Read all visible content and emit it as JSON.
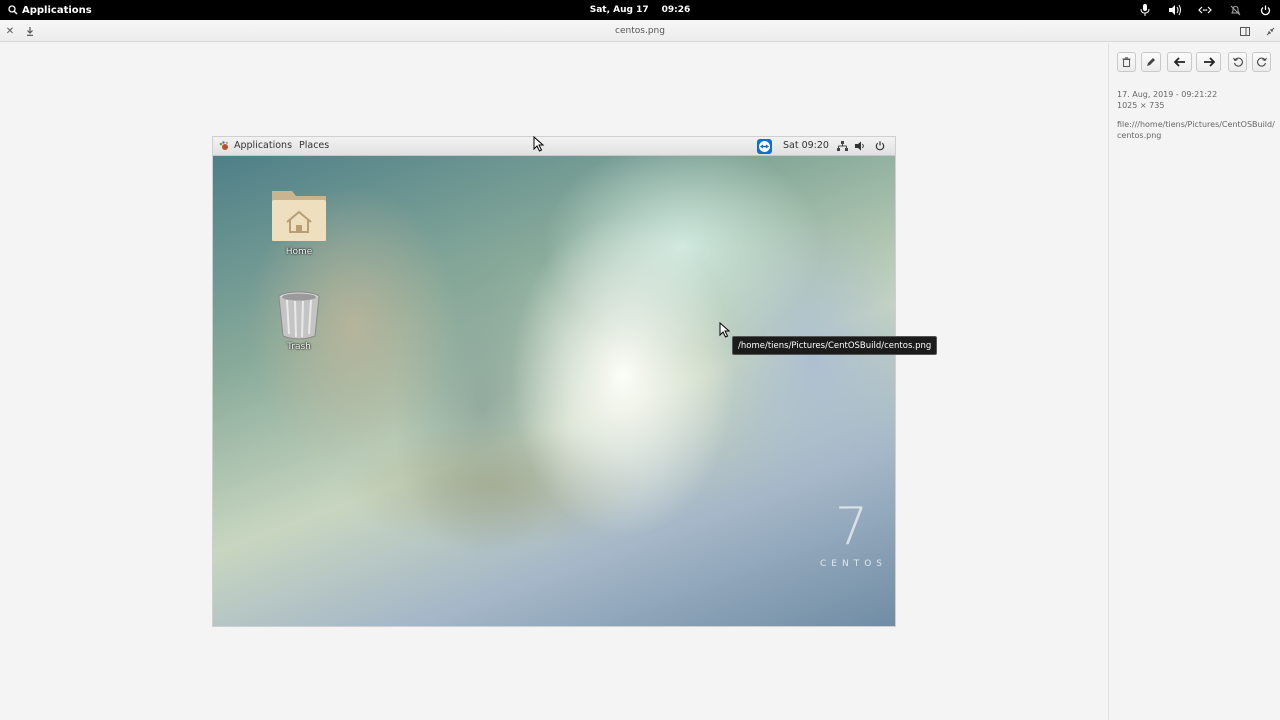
{
  "topbar": {
    "apps_label": "Applications",
    "date": "Sat, Aug 17",
    "time": "09:26"
  },
  "viewer": {
    "title": "centos.png"
  },
  "sidebar": {
    "date_time": "17. Aug, 2019 - 09:21:22",
    "dimensions": "1025 × 735",
    "file_path_line1": "file:///home/tiens/Pictures/CentOSBuild/",
    "file_path_line2": "centos.png"
  },
  "image": {
    "panel": {
      "applications_label": "Applications",
      "places_label": "Places",
      "clock": "Sat 09:20"
    },
    "desktop_icons": [
      {
        "label": "Home"
      },
      {
        "label": "Trash"
      }
    ],
    "watermark_number": "7",
    "watermark_text": "CENTOS"
  },
  "tooltip": "/home/tiens/Pictures/CentOSBuild/centos.png"
}
